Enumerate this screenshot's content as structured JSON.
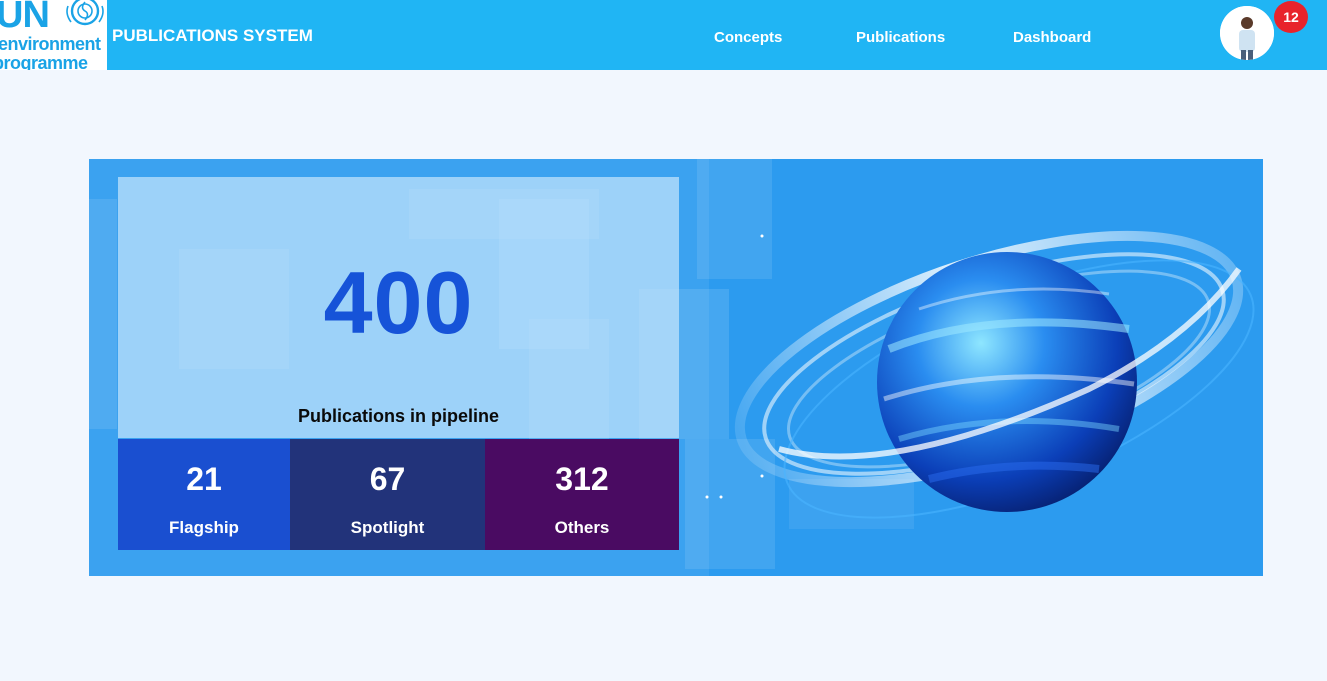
{
  "header": {
    "logo": {
      "line1": "UN",
      "line2": "environment",
      "line3": "programme"
    },
    "title": "PUBLICATIONS SYSTEM",
    "nav": [
      {
        "label": "Concepts"
      },
      {
        "label": "Publications"
      },
      {
        "label": "Dashboard"
      }
    ],
    "notification_count": "12"
  },
  "summary": {
    "total": "400",
    "total_label": "Publications in pipeline",
    "categories": [
      {
        "value": "21",
        "label": "Flagship",
        "color": "#1a4fd0"
      },
      {
        "value": "67",
        "label": "Spotlight",
        "color": "#22337a"
      },
      {
        "value": "312",
        "label": "Others",
        "color": "#4a0b62"
      }
    ]
  },
  "colors": {
    "header_bg": "#20b5f4",
    "page_bg": "#f2f7fe",
    "banner_bg": "#2c9bef",
    "total_color": "#1653d8",
    "badge_bg": "#e8232b"
  }
}
